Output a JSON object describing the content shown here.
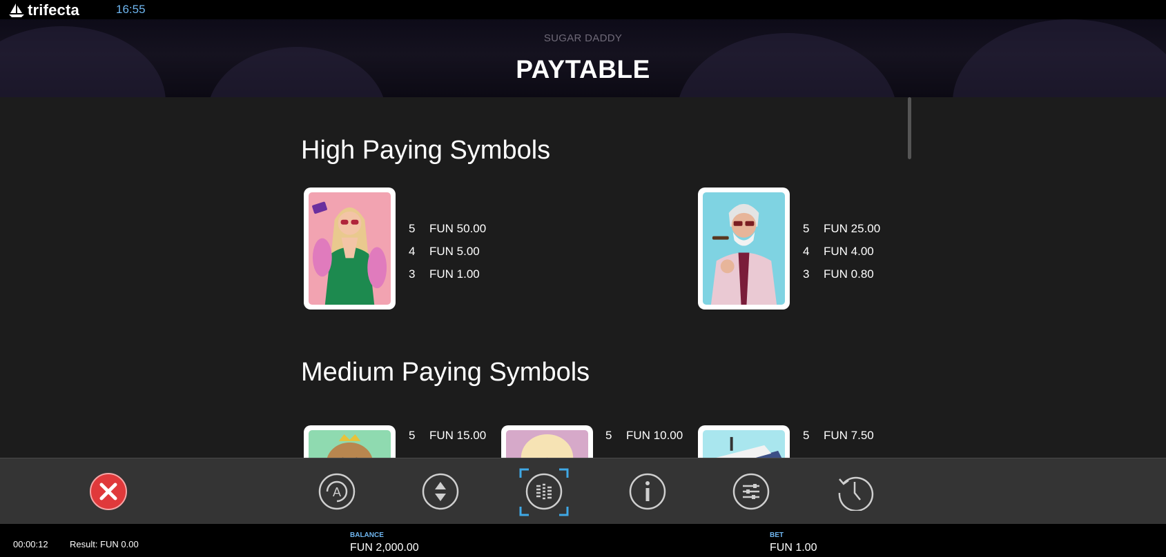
{
  "app": {
    "brand": "trifecta",
    "clock": "16:55"
  },
  "header": {
    "game_name": "SUGAR DADDY",
    "title": "PAYTABLE"
  },
  "sections": {
    "high": {
      "title": "High Paying Symbols",
      "symbols": [
        {
          "icon": "woman-in-green-dress-icon",
          "pays": [
            {
              "count": "5",
              "value": "FUN 50.00"
            },
            {
              "count": "4",
              "value": "FUN 5.00"
            },
            {
              "count": "3",
              "value": "FUN 1.00"
            }
          ]
        },
        {
          "icon": "sugar-daddy-with-cigar-icon",
          "pays": [
            {
              "count": "5",
              "value": "FUN 25.00"
            },
            {
              "count": "4",
              "value": "FUN 4.00"
            },
            {
              "count": "3",
              "value": "FUN 0.80"
            }
          ]
        }
      ]
    },
    "medium": {
      "title": "Medium Paying Symbols",
      "symbols": [
        {
          "icon": "dog-with-crown-icon",
          "pays": [
            {
              "count": "5",
              "value": "FUN 15.00"
            }
          ]
        },
        {
          "icon": "poodle-icon",
          "pays": [
            {
              "count": "5",
              "value": "FUN 10.00"
            }
          ]
        },
        {
          "icon": "yacht-icon",
          "pays": [
            {
              "count": "5",
              "value": "FUN 7.50"
            }
          ]
        }
      ]
    }
  },
  "toolbar": {
    "buttons": [
      "close-icon",
      "autoplay-icon",
      "bet-adjust-icon",
      "paytable-icon",
      "info-icon",
      "settings-icon",
      "history-icon"
    ],
    "colors": {
      "close": "#e0393b",
      "active": "#3fa9e6",
      "icon": "#cfcfcf"
    }
  },
  "status": {
    "timer": "00:00:12",
    "result": "Result: FUN 0.00",
    "balance_label": "BALANCE",
    "balance_value": "FUN 2,000.00",
    "bet_label": "BET",
    "bet_value": "FUN 1.00"
  }
}
